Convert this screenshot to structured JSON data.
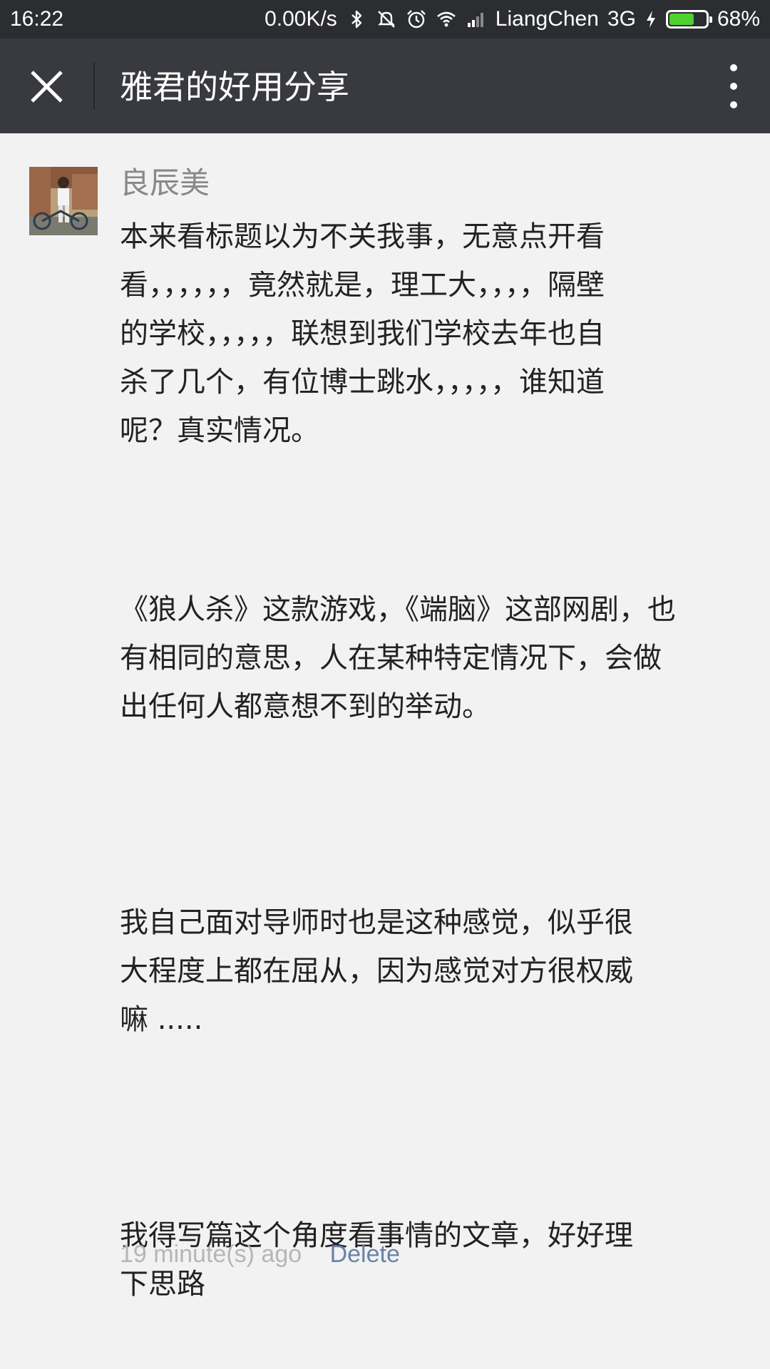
{
  "status_bar": {
    "time": "16:22",
    "network_speed": "0.00K/s",
    "carrier": "LiangChen",
    "network_type": "3G",
    "battery_percent": "68%",
    "battery_level": 0.68,
    "battery_color": "#4fd12f",
    "icons": [
      "bluetooth-icon",
      "mute-icon",
      "alarm-icon",
      "wifi-icon",
      "signal-icon",
      "charging-icon",
      "battery-icon"
    ]
  },
  "top_bar": {
    "title": "雅君的好用分享",
    "close_icon": "close-icon",
    "more_icon": "more-vertical-icon"
  },
  "comment": {
    "author": "良辰美",
    "paragraphs": [
      "本来看标题以为不关我事，无意点开看\n看，，，，，，竟然就是，理工大，，，，隔壁\n的学校，，，，，联想到我们学校去年也自\n杀了几个，有位博士跳水，，，，，谁知道\n呢？真实情况。",
      "《狼人杀》这款游戏，《端脑》这部网剧，也\n有相同的意思，人在某种特定情况下，会做\n出任何人都意想不到的举动。",
      "我自己面对导师时也是这种感觉，似乎很\n大程度上都在屈从，因为感觉对方很权威\n嘛 .....",
      "我得写篇这个角度看事情的文章，好好理\n下思路"
    ],
    "time_ago": "19 minute(s) ago",
    "delete_label": "Delete"
  },
  "colors": {
    "background": "#f2f2f2",
    "top_bar": "#393a3f",
    "status_bar": "#2b2d30",
    "link": "#6a82a8"
  }
}
